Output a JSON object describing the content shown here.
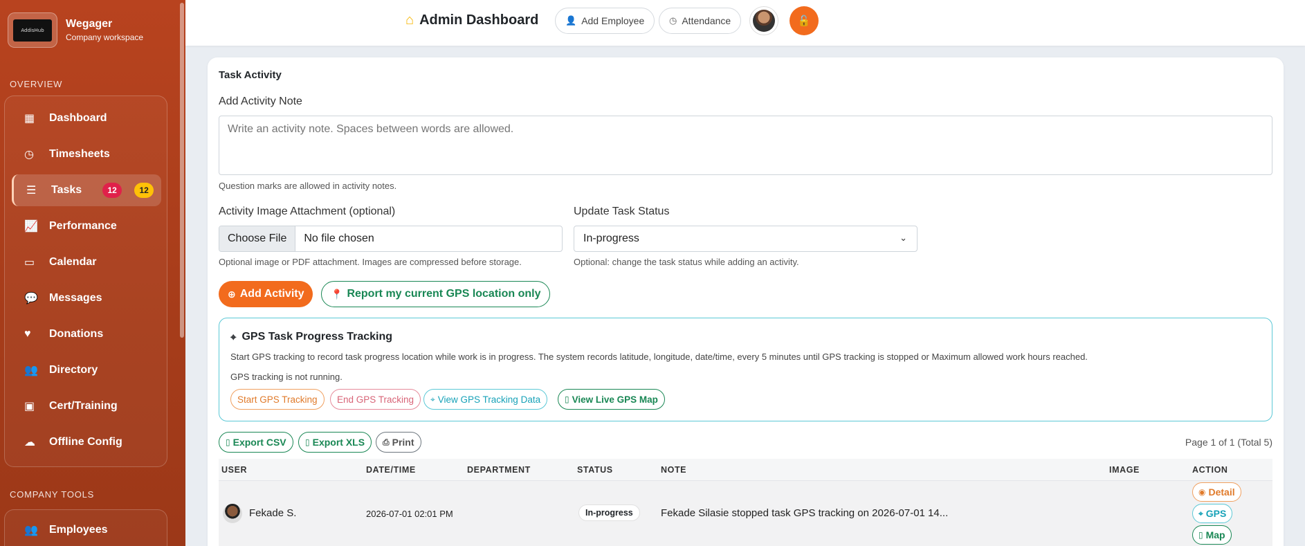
{
  "brand": {
    "name": "Wegager",
    "subtitle": "Company workspace",
    "logo_text": "AddisHub"
  },
  "sidebar": {
    "overview_label": "OVERVIEW",
    "company_tools_label": "COMPANY TOOLS",
    "items": [
      {
        "label": "Dashboard",
        "icon": "dashboard-icon"
      },
      {
        "label": "Timesheets",
        "icon": "clock-icon"
      },
      {
        "label": "Tasks",
        "icon": "list-icon",
        "badge_red": "12",
        "badge_yellow": "12",
        "active": true
      },
      {
        "label": "Performance",
        "icon": "chart-line-icon"
      },
      {
        "label": "Calendar",
        "icon": "calendar-icon"
      },
      {
        "label": "Messages",
        "icon": "chat-icon"
      },
      {
        "label": "Donations",
        "icon": "heart-icon"
      },
      {
        "label": "Directory",
        "icon": "people-icon"
      },
      {
        "label": "Cert/Training",
        "icon": "certificate-icon"
      },
      {
        "label": "Offline Config",
        "icon": "cloud-icon"
      }
    ],
    "tools_items": [
      {
        "label": "Employees",
        "icon": "people-icon"
      }
    ]
  },
  "topbar": {
    "title": "Admin Dashboard",
    "add_employee": "Add Employee",
    "attendance": "Attendance"
  },
  "card": {
    "title": "Task Activity",
    "note_label": "Add Activity Note",
    "note_placeholder": "Write an activity note. Spaces between words are allowed.",
    "note_help": "Question marks are allowed in activity notes.",
    "attachment_label": "Activity Image Attachment (optional)",
    "file_button": "Choose File",
    "file_status": "No file chosen",
    "attachment_help": "Optional image or PDF attachment. Images are compressed before storage.",
    "status_label": "Update Task Status",
    "status_value": "In-progress",
    "status_help": "Optional: change the task status while adding an activity.",
    "add_activity": "Add Activity",
    "report_gps": "Report my current GPS location only"
  },
  "gps": {
    "title": "GPS Task Progress Tracking",
    "description": "Start GPS tracking to record task progress location while work is in progress. The system records latitude, longitude, date/time, every 5 minutes until GPS tracking is stopped or Maximum allowed work hours reached.",
    "status": "GPS tracking is not running.",
    "start": "Start GPS Tracking",
    "end": "End GPS Tracking",
    "view_data": "View GPS Tracking Data",
    "view_map": "View Live GPS Map"
  },
  "table": {
    "export_csv": "Export CSV",
    "export_xls": "Export XLS",
    "print": "Print",
    "page_info": "Page 1 of 1 (Total 5)",
    "columns": [
      "USER",
      "DATE/TIME",
      "DEPARTMENT",
      "STATUS",
      "NOTE",
      "IMAGE",
      "ACTION"
    ],
    "rows": [
      {
        "user": "Fekade S.",
        "datetime": "2026-07-01 02:01 PM",
        "department": "",
        "status": "In-progress",
        "note": "Fekade Silasie stopped task GPS tracking on 2026-07-01 14...",
        "image": "",
        "actions": {
          "detail": "Detail",
          "gps": "GPS",
          "map": "Map"
        }
      }
    ]
  },
  "colors": {
    "accent": "#f26b1d",
    "success": "#198754",
    "info": "#17a2b8",
    "danger": "#e0214a"
  }
}
